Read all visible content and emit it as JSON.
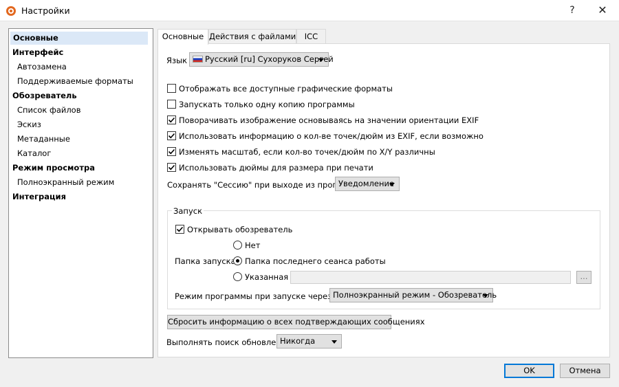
{
  "window": {
    "title": "Настройки",
    "help_label": "?",
    "close_label": "✕"
  },
  "sidebar": {
    "items": [
      {
        "label": "Основные"
      },
      {
        "label": "Интерфейс"
      },
      {
        "label": "Автозамена"
      },
      {
        "label": "Поддерживаемые форматы"
      },
      {
        "label": "Обозреватель"
      },
      {
        "label": "Список файлов"
      },
      {
        "label": "Эскиз"
      },
      {
        "label": "Метаданные"
      },
      {
        "label": "Каталог"
      },
      {
        "label": "Режим просмотра"
      },
      {
        "label": "Полноэкранный режим"
      },
      {
        "label": "Интеграция"
      }
    ]
  },
  "tabs": [
    {
      "label": "Основные"
    },
    {
      "label": "Действия с файлами"
    },
    {
      "label": "ICC"
    }
  ],
  "general": {
    "language_label": "Язык",
    "language_value": "Русский [ru] Сухоруков Сергей",
    "checkboxes": [
      {
        "label": "Отображать все доступные графические форматы",
        "checked": false
      },
      {
        "label": "Запускать только одну копию программы",
        "checked": false
      },
      {
        "label": "Поворачивать изображение основываясь на значении ориентации EXIF",
        "checked": true
      },
      {
        "label": "Использовать информацию о кол-ве точек/дюйм из EXIF, если возможно",
        "checked": true
      },
      {
        "label": "Изменять масштаб, если кол-во точек/дюйм по X/Y различны",
        "checked": true
      },
      {
        "label": "Использовать дюймы для размера при печати",
        "checked": true
      }
    ],
    "session_label": "Сохранять \"Сессию\" при выходе из программы",
    "session_value": "Уведомление"
  },
  "startup": {
    "group_label": "Запуск",
    "open_browser_label": "Открывать обозреватель",
    "open_browser_checked": true,
    "folder_label": "Папка запуска:",
    "radios": [
      {
        "label": "Нет",
        "selected": false
      },
      {
        "label": "Папка последнего сеанса работы",
        "selected": true
      },
      {
        "label": "Указанная",
        "selected": false
      }
    ],
    "path_value": "",
    "browse_label": "...",
    "mode_label": "Режим программы  при запуске через файл",
    "mode_value": "Полноэкранный режим - Обозреватель"
  },
  "reset_button_label": "Сбросить информацию о всех подтверждающих сообщениях",
  "updates_label": "Выполнять поиск обновлений",
  "updates_value": "Никогда",
  "footer": {
    "ok_label": "OK",
    "cancel_label": "Отмена"
  }
}
